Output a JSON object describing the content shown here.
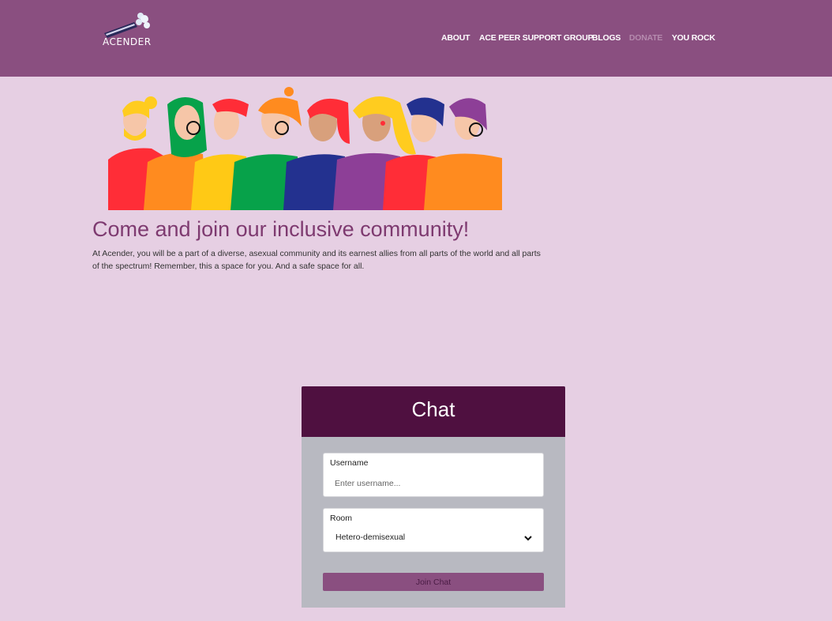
{
  "brand": {
    "name": "ACENDER"
  },
  "nav": {
    "items": [
      {
        "label": "ABOUT"
      },
      {
        "label": "ACE PEER SUPPORT GROUP"
      },
      {
        "label": "BLOGS"
      },
      {
        "label": "DONATE"
      },
      {
        "label": "YOU ROCK"
      }
    ]
  },
  "main": {
    "headline": "Come and join our inclusive community!",
    "intro": "At Acender, you will be a part of a diverse, asexual community and its earnest allies from all parts of the world and all parts of the spectrum! Remember, this a space for you. And a safe space for all."
  },
  "chat": {
    "title": "Chat",
    "username_label": "Username",
    "username_value": "",
    "username_placeholder": "Enter username...",
    "room_label": "Room",
    "room_selected": "Hetero-demisexual",
    "join_label": "Join Chat"
  },
  "colors": {
    "header": "#8a4f80",
    "background": "#e6cfe3",
    "chat_header": "#4f1040",
    "chat_body": "#b8b9c1",
    "accent": "#8a4f80"
  }
}
